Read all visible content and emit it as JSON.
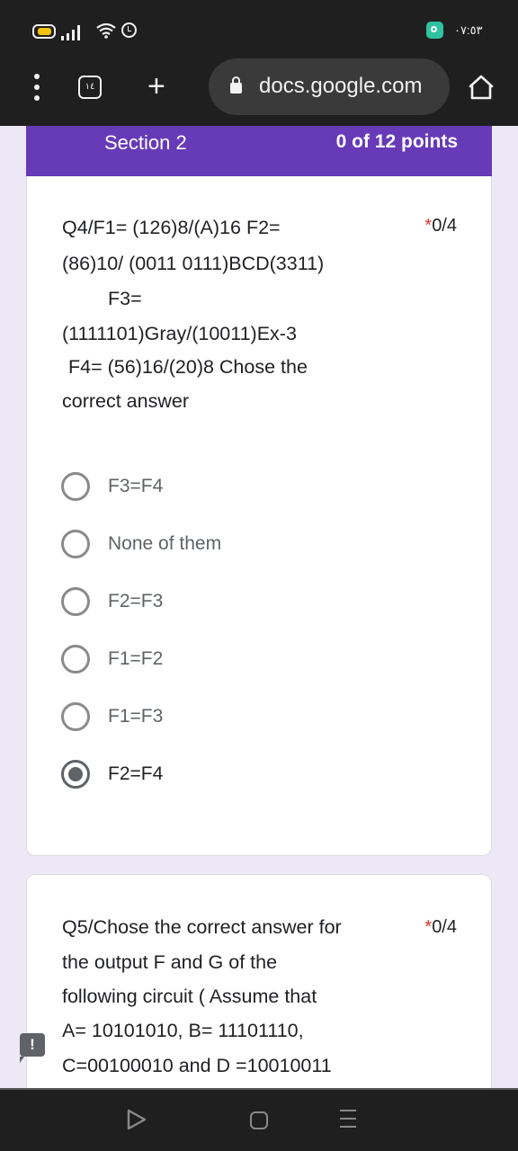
{
  "status_bar": {
    "time": "٠٧:٥٣",
    "icons": [
      "battery-icon",
      "signal-icon",
      "wifi-icon",
      "alarm-icon",
      "app-notification-icon"
    ]
  },
  "browser": {
    "tab_count": "١٤",
    "new_tab_label": "+",
    "url": "docs.google.com",
    "icons": [
      "menu-dots-icon",
      "tabs-icon",
      "plus-icon",
      "lock-icon",
      "home-icon"
    ]
  },
  "section": {
    "title": "Section  2",
    "points": "0 of 12 points",
    "accent_color": "#673ab7"
  },
  "question4": {
    "lines": [
      "Q4/F1= (126)8/(A)16        F2=",
      "(86)10/ (0011 0111)BCD(3311)",
      "F3=",
      "(1111101)Gray/(10011)Ex-3",
      "F4= (56)16/(20)8       Chose the",
      "correct answer"
    ],
    "required_marker": "*",
    "score": "0/4",
    "options": [
      {
        "label": "F3=F4",
        "selected": false
      },
      {
        "label": "None of them",
        "selected": false
      },
      {
        "label": "F2=F3",
        "selected": false
      },
      {
        "label": "F1=F2",
        "selected": false
      },
      {
        "label": "F1=F3",
        "selected": false
      },
      {
        "label": "F2=F4",
        "selected": true
      }
    ]
  },
  "question5": {
    "lines": [
      "Q5/Chose the correct answer for",
      "the output F and G of the",
      "following circuit  ( Assume that",
      "A= 10101010, B= 11101110,",
      "C=00100010 and D =10010011"
    ],
    "required_marker": "*",
    "score": "0/4"
  },
  "feedback_flag": "!",
  "nav_bar": {
    "icons": [
      "back-icon",
      "home-icon",
      "recents-icon"
    ]
  }
}
